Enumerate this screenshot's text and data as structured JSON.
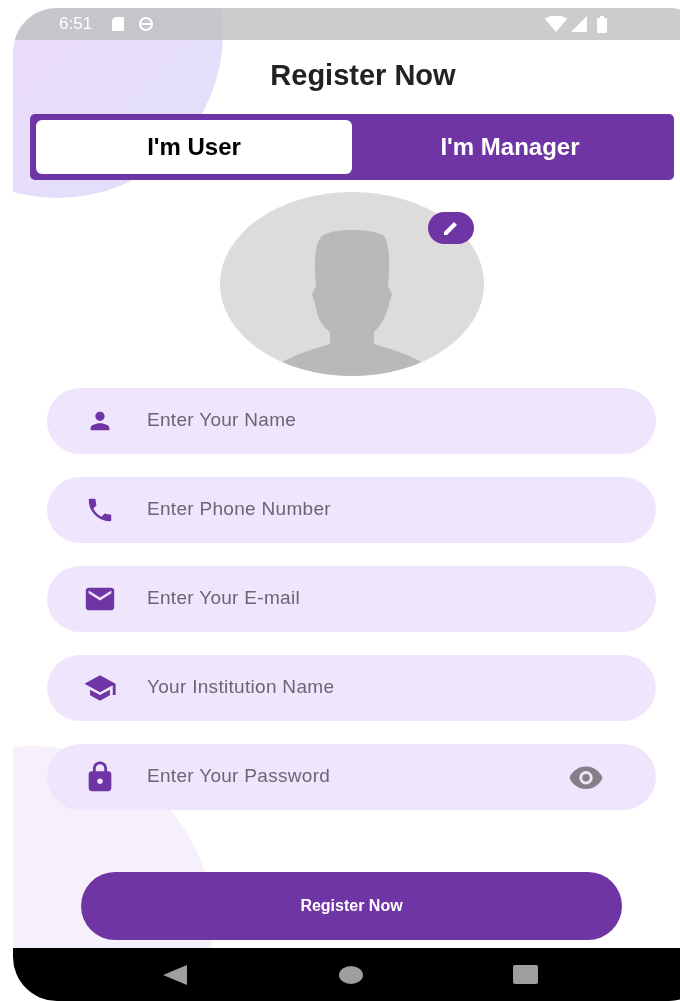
{
  "status_bar": {
    "time": "6:51"
  },
  "title": "Register Now",
  "tabs": [
    {
      "label": "I'm User",
      "selected": true
    },
    {
      "label": "I'm Manager",
      "selected": false
    }
  ],
  "fields": [
    {
      "kind": "name",
      "placeholder": "Enter Your Name"
    },
    {
      "kind": "phone",
      "placeholder": "Enter Phone Number"
    },
    {
      "kind": "email",
      "placeholder": "Enter Your E-mail"
    },
    {
      "kind": "institution",
      "placeholder": "Your Institution Name"
    },
    {
      "kind": "password",
      "placeholder": "Enter Your Password"
    }
  ],
  "submit_button": "Register Now"
}
